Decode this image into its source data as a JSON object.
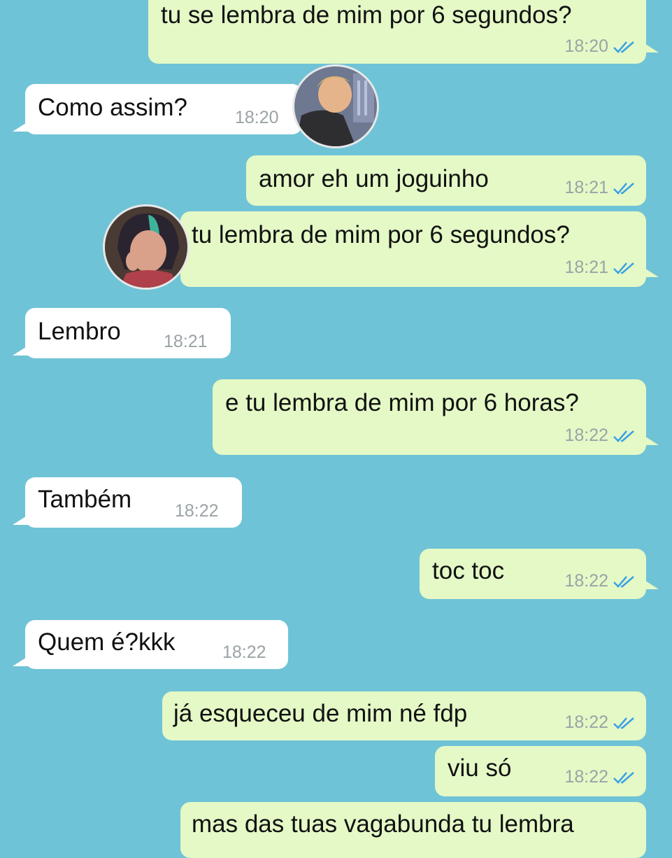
{
  "messages": [
    {
      "text": "tu se lembra de mim por 6 segundos?",
      "time": "18:20",
      "dir": "out"
    },
    {
      "text": "Como assim?",
      "time": "18:20",
      "dir": "in"
    },
    {
      "text": "amor eh um joguinho",
      "time": "18:21",
      "dir": "out"
    },
    {
      "text": "tu lembra de mim por 6 segundos?",
      "time": "18:21",
      "dir": "out"
    },
    {
      "text": "Lembro",
      "time": "18:21",
      "dir": "in"
    },
    {
      "text": "e tu lembra de mim por 6 horas?",
      "time": "18:22",
      "dir": "out"
    },
    {
      "text": "Também",
      "time": "18:22",
      "dir": "in"
    },
    {
      "text": "toc toc",
      "time": "18:22",
      "dir": "out"
    },
    {
      "text": "Quem é?kkk",
      "time": "18:22",
      "dir": "in"
    },
    {
      "text": "já esqueceu de mim né fdp",
      "time": "18:22",
      "dir": "out"
    },
    {
      "text": "viu só",
      "time": "18:22",
      "dir": "out"
    },
    {
      "text": "mas das tuas vagabunda tu lembra",
      "time": "",
      "dir": "out"
    }
  ],
  "colors": {
    "background": "#6fc3d6",
    "outgoing_bubble": "#e4f9c6",
    "incoming_bubble": "#ffffff",
    "read_ticks": "#3aa0e6"
  },
  "icons": {
    "read_receipt": "double-check-icon"
  }
}
